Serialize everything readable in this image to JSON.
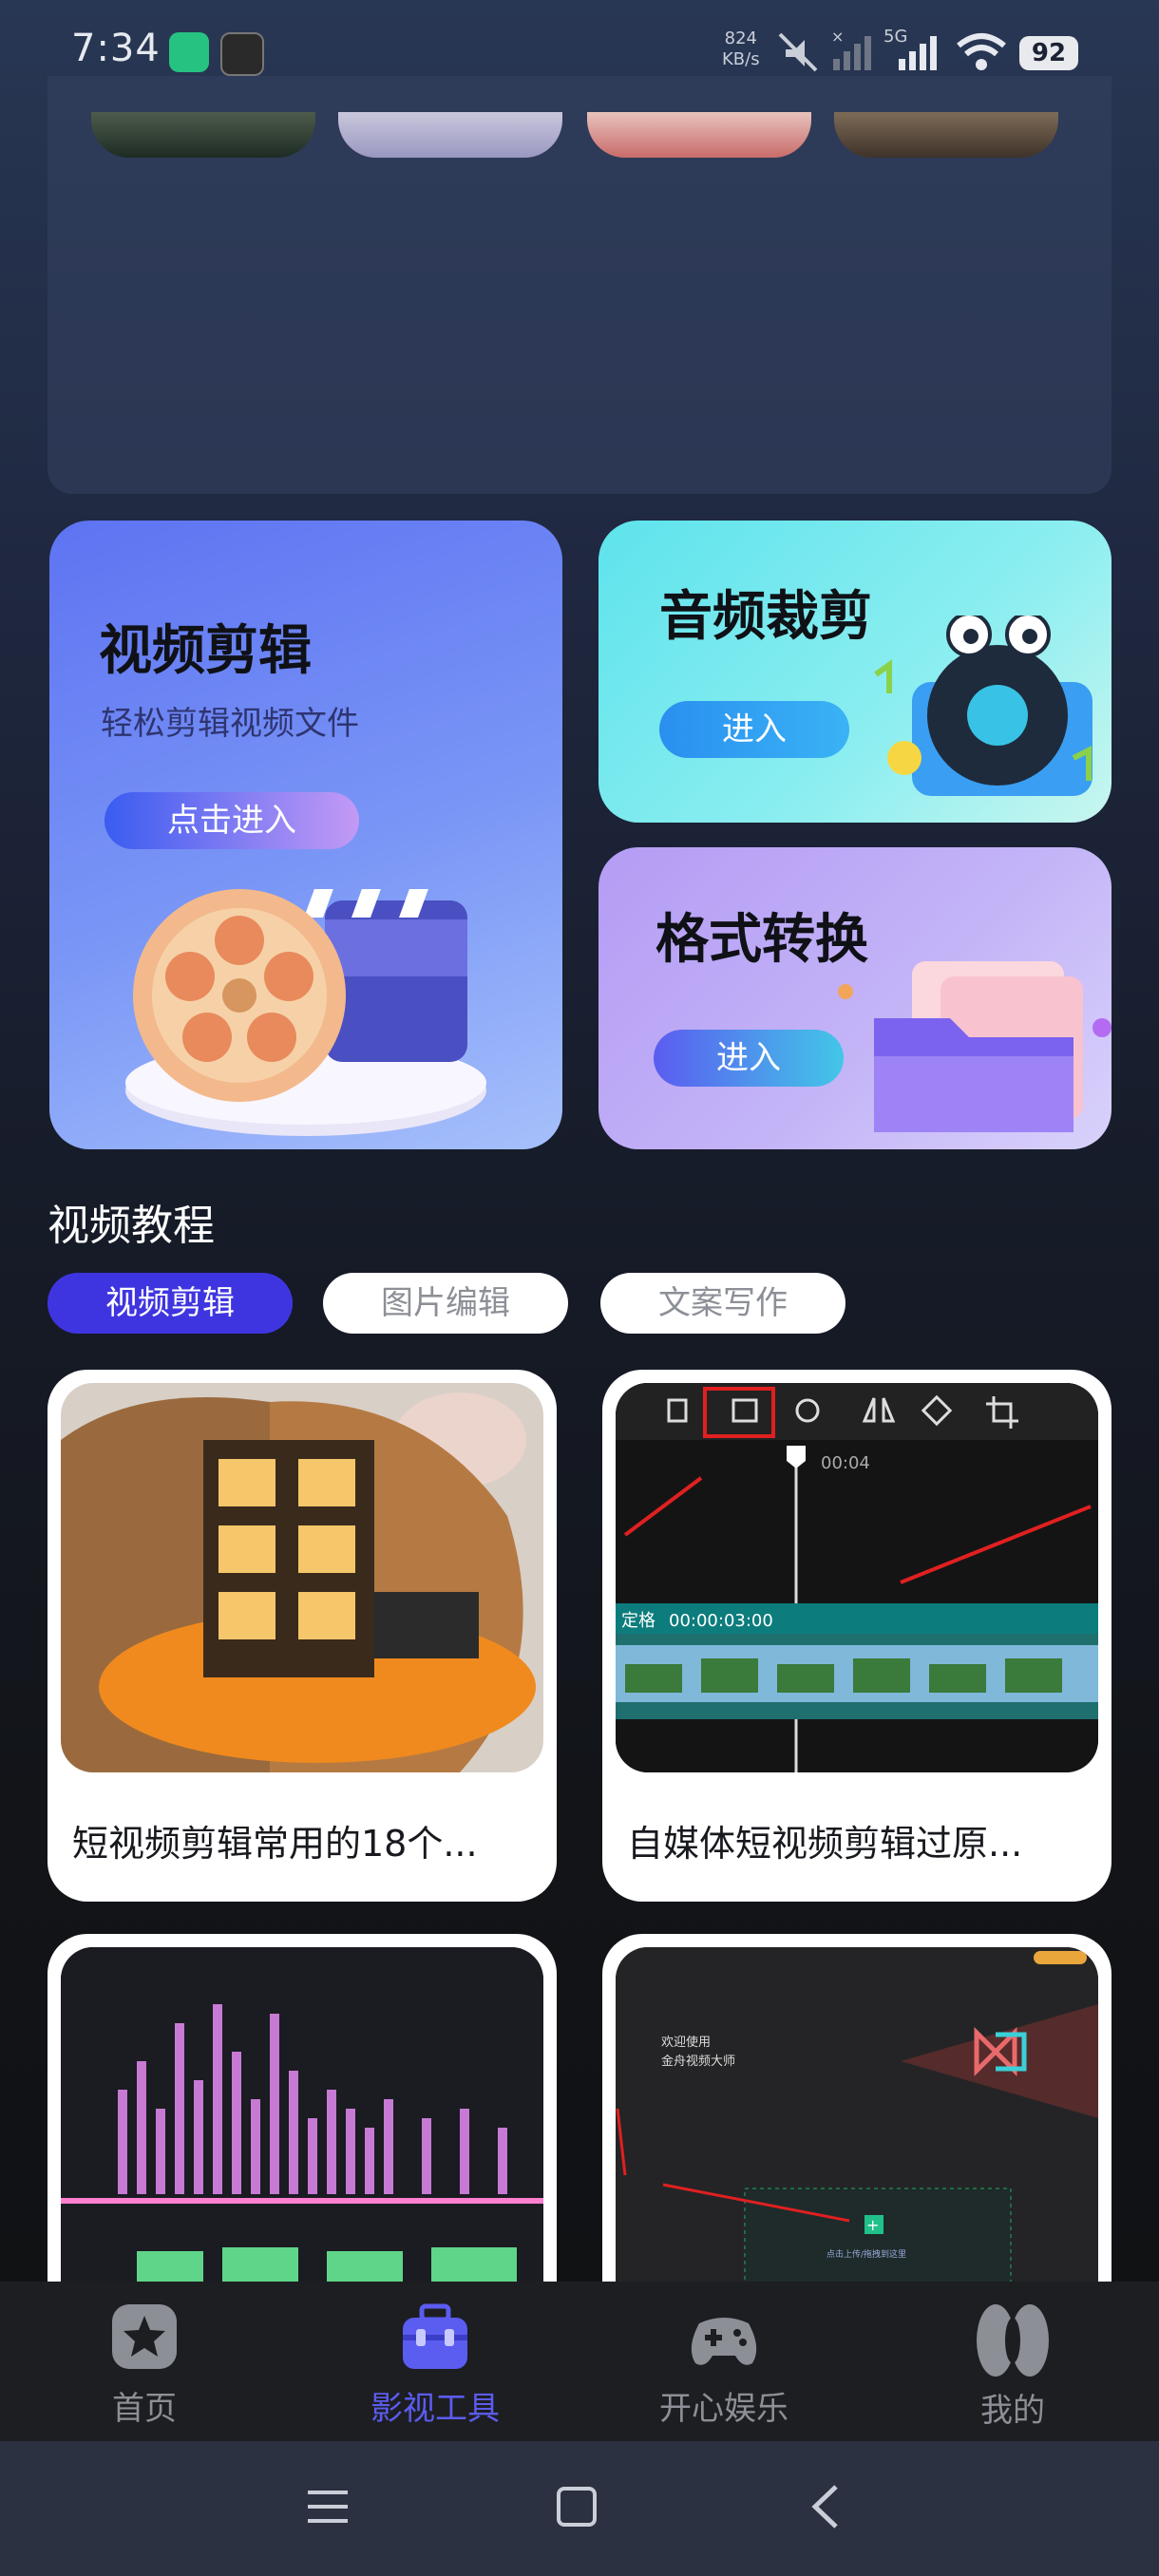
{
  "status_bar": {
    "time": "7:34",
    "net_speed_value": "824",
    "net_speed_unit": "KB/s",
    "network_label": "5G",
    "battery": "92"
  },
  "tools": {
    "video_edit": {
      "title": "视频剪辑",
      "subtitle": "轻松剪辑视频文件",
      "button": "点击进入"
    },
    "audio_cut": {
      "title": "音频裁剪",
      "button": "进入"
    },
    "format_convert": {
      "title": "格式转换",
      "button": "进入"
    }
  },
  "tutorials": {
    "title": "视频教程",
    "tabs": [
      {
        "label": "视频剪辑",
        "active": true
      },
      {
        "label": "图片编辑",
        "active": false
      },
      {
        "label": "文案写作",
        "active": false
      }
    ],
    "cards": [
      {
        "title": "短视频剪辑常用的18个..."
      },
      {
        "title": "自媒体短视频剪辑过原..."
      }
    ],
    "editor_thumb": {
      "time_mark": "00:04",
      "clip_label": "定格",
      "clip_time": "00:00:03:00"
    },
    "welcome_thumb": {
      "line1": "欢迎使用",
      "line2": "金舟视频大师",
      "upload_hint": "点击上传/拖拽到这里"
    }
  },
  "bottom_nav": {
    "items": [
      {
        "label": "首页",
        "icon": "star-icon",
        "active": false
      },
      {
        "label": "影视工具",
        "icon": "toolbox-icon",
        "active": true
      },
      {
        "label": "开心娱乐",
        "icon": "gamepad-icon",
        "active": false
      },
      {
        "label": "我的",
        "icon": "profile-icon",
        "active": false
      }
    ]
  },
  "colors": {
    "accent": "#3f35e0",
    "nav_active": "#5b5cf0",
    "nav_inactive": "#8c8f96"
  }
}
